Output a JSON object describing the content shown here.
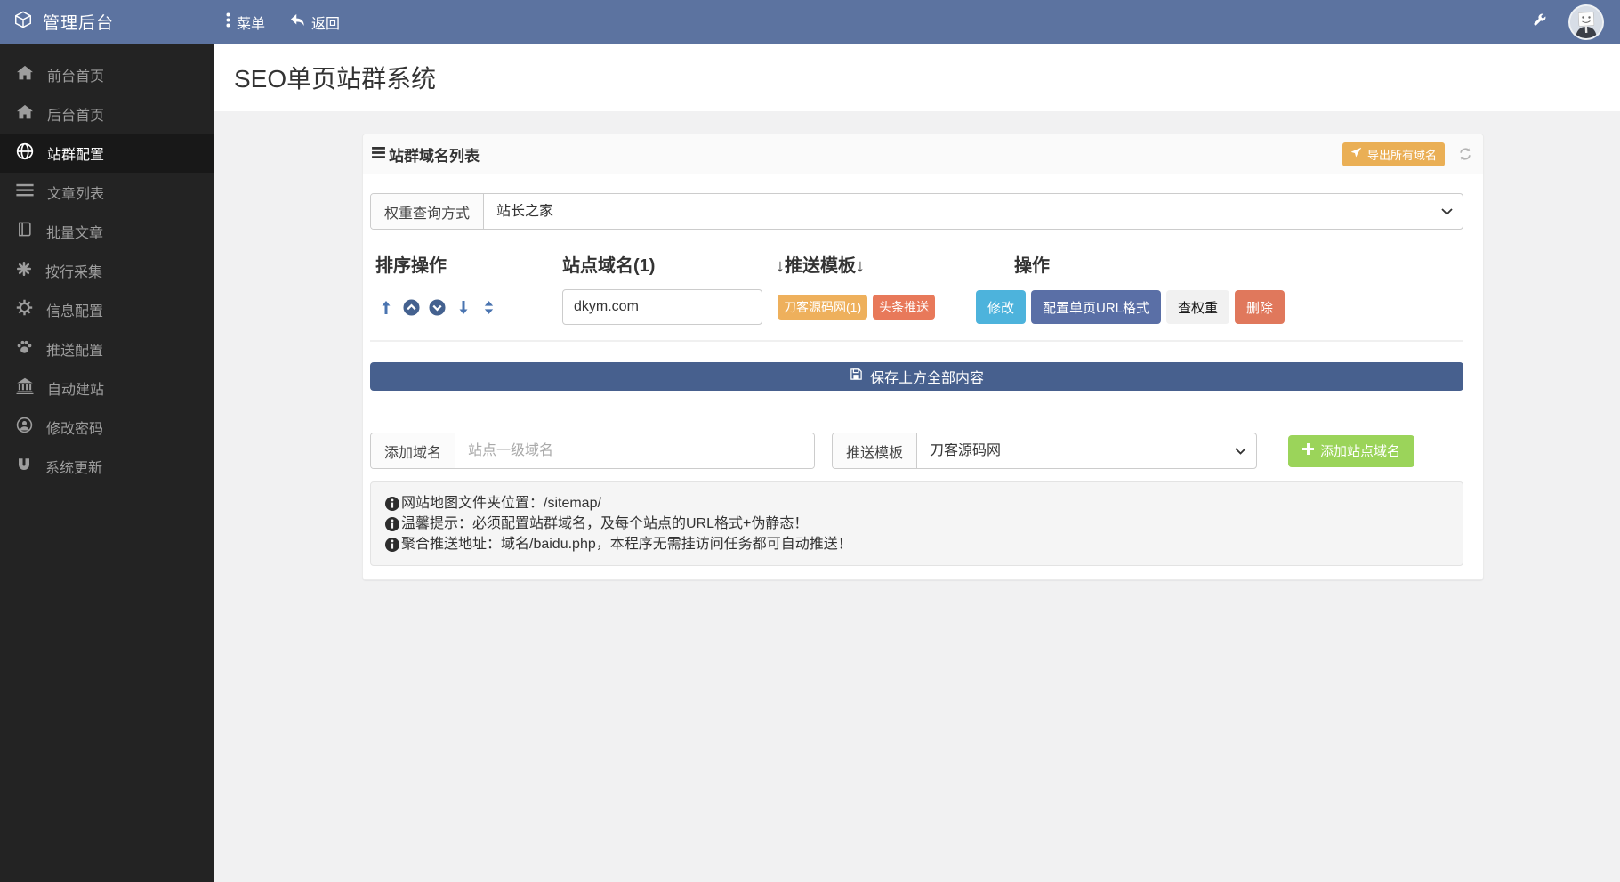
{
  "navbar": {
    "brand": "管理后台",
    "menu_label": "菜单",
    "back_label": "返回",
    "icons": {
      "brand": "cube-icon",
      "menu": "ellipsis-icon",
      "back": "reply-icon",
      "tools": "wrench-icon",
      "avatar": "user-avatar"
    }
  },
  "sidebar": {
    "items": [
      {
        "label": "前台首页",
        "icon": "home-icon",
        "active": false
      },
      {
        "label": "后台首页",
        "icon": "home-icon",
        "active": false
      },
      {
        "label": "站群配置",
        "icon": "globe-icon",
        "active": true
      },
      {
        "label": "文章列表",
        "icon": "list-icon",
        "active": false
      },
      {
        "label": "批量文章",
        "icon": "book-icon",
        "active": false
      },
      {
        "label": "按行采集",
        "icon": "asterisk-icon",
        "active": false
      },
      {
        "label": "信息配置",
        "icon": "gear-icon",
        "active": false
      },
      {
        "label": "推送配置",
        "icon": "paw-icon",
        "active": false
      },
      {
        "label": "自动建站",
        "icon": "bank-icon",
        "active": false
      },
      {
        "label": "修改密码",
        "icon": "user-circle-icon",
        "active": false
      },
      {
        "label": "系统更新",
        "icon": "magnet-icon",
        "active": false
      }
    ]
  },
  "page": {
    "title": "SEO单页站群系统"
  },
  "panel": {
    "title": "站群域名列表",
    "export_button": "导出所有域名",
    "weight_query": {
      "label": "权重查询方式",
      "value": "站长之家"
    },
    "table": {
      "headers": [
        "排序操作",
        "站点域名(1)",
        "↓推送模板↓",
        "操作"
      ],
      "row": {
        "domain": "dkym.com",
        "badges": [
          {
            "label": "刀客源码网(1)",
            "color": "#eeb05c"
          },
          {
            "label": "头条推送",
            "color": "#e8795a"
          }
        ],
        "actions": [
          {
            "label": "修改",
            "color": "#4db3dc"
          },
          {
            "label": "配置单页URL格式",
            "color": "#5a6fa6"
          },
          {
            "label": "查权重",
            "color": "#f1f1f1"
          },
          {
            "label": "删除",
            "color": "#e0785c"
          }
        ]
      }
    },
    "save_button": "保存上方全部内容",
    "add_domain": {
      "label": "添加域名",
      "placeholder": "站点一级域名"
    },
    "push_template": {
      "label": "推送模板",
      "value": "刀客源码网"
    },
    "add_button": "添加站点域名",
    "notes": [
      "网站地图文件夹位置：/sitemap/",
      "温馨提示：必须配置站群域名，及每个站点的URL格式+伪静态！",
      "聚合推送地址：域名/baidu.php，本程序无需挂访问任务都可自动推送！"
    ]
  },
  "colors": {
    "navbar": "#5c73a0",
    "sidebar_bg": "#232323",
    "sidebar_active_bg": "#181818",
    "body_bg": "#f1f1f2",
    "export_button": "#eaaf55",
    "save_button": "#47608e",
    "add_button": "#9bd45a",
    "well_bg": "#f5f5f5"
  }
}
